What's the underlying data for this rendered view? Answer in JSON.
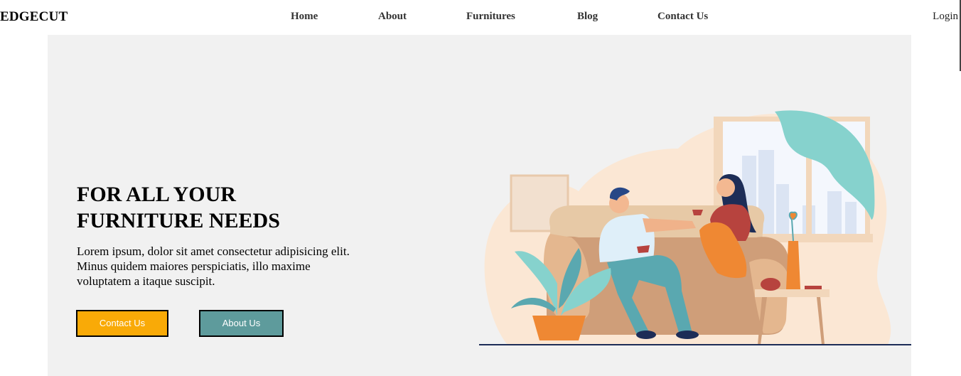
{
  "navbar": {
    "brand": "EDGECUT",
    "links": [
      "Home",
      "About",
      "Furnitures",
      "Blog",
      "Contact Us"
    ],
    "login": "Login"
  },
  "hero": {
    "title_line1": "FOR ALL YOUR",
    "title_line2": "FURNITURE NEEDS",
    "text": "Lorem ipsum, dolor sit amet consectetur adipisicing elit. Minus quidem maiores perspiciatis, illo maxime voluptatem a itaque suscipit.",
    "buttons": {
      "contact": "Contact Us",
      "about": "About Us"
    }
  },
  "colors": {
    "hero_background": "#f1f1f1",
    "contact_button": "#f9aa07",
    "about_button": "#5e9b9c"
  }
}
